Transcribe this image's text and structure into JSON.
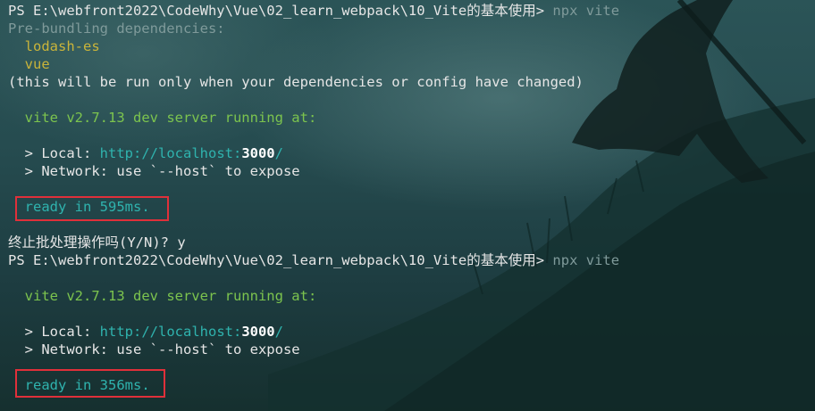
{
  "terminal": {
    "lines": [
      {
        "prompt": "PS E:\\webfront2022\\CodeWhy\\Vue\\02_learn_webpack\\10_Vite的基本使用> ",
        "cmd": "npx vite"
      },
      {
        "text": "Pre-bundling dependencies:"
      },
      {
        "text": "lodash-es"
      },
      {
        "text": "vue"
      },
      {
        "text": "(this will be run only when your dependencies or config have changed)"
      },
      {
        "text": ""
      },
      {
        "vite": "vite v2.7.13",
        "rest": " dev server running at:"
      },
      {
        "text": ""
      },
      {
        "local_label": "> Local: ",
        "url_pre": "http://localhost:",
        "port": "3000",
        "url_post": "/"
      },
      {
        "text": "> Network: use `--host` to expose"
      },
      {
        "text": ""
      },
      {
        "text": "ready in 595ms."
      },
      {
        "text": ""
      },
      {
        "text": "终止批处理操作吗(Y/N)? y"
      },
      {
        "prompt": "PS E:\\webfront2022\\CodeWhy\\Vue\\02_learn_webpack\\10_Vite的基本使用> ",
        "cmd": "npx vite"
      },
      {
        "text": ""
      },
      {
        "vite": "vite v2.7.13",
        "rest": " dev server running at:"
      },
      {
        "text": ""
      },
      {
        "local_label": "> Local: ",
        "url_pre": "http://localhost:",
        "port": "3000",
        "url_post": "/"
      },
      {
        "text": "> Network: use `--host` to expose"
      },
      {
        "text": ""
      },
      {
        "text": "ready in 356ms."
      }
    ]
  },
  "colors": {
    "highlight_box": "#e0303a",
    "ready_text": "#2fb3ae",
    "vite_version": "#7cc44e",
    "dependency": "#c9b43a"
  }
}
